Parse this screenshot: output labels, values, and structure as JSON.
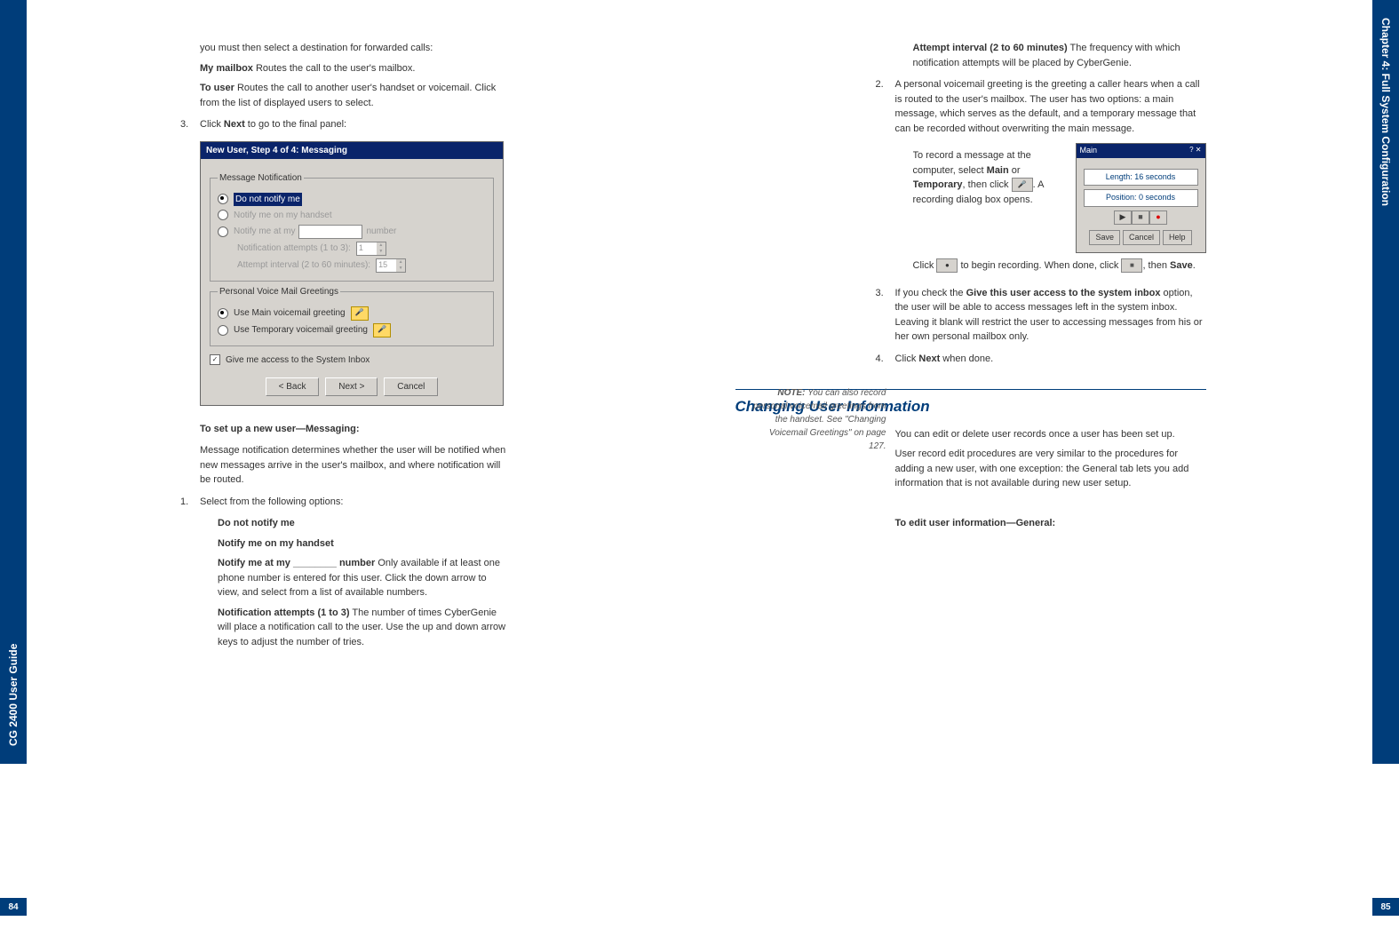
{
  "leftTab": "CG 2400 User Guide",
  "rightTab": "Chapter 4: Full System Configuration",
  "pageNumLeft": "84",
  "pageNumRight": "85",
  "left": {
    "intro": "you must then select a destination for forwarded calls:",
    "myMailbox": "My mailbox",
    "myMailboxDesc": "  Routes the call to the user's mailbox.",
    "toUser": "To user",
    "toUserDesc": "  Routes the call to another user's handset or voicemail. Click from the list of displayed users to select.",
    "step3num": "3.",
    "step3a": "Click ",
    "step3b": "Next",
    "step3c": " to go to the final panel:",
    "dlg": {
      "title": "New User, Step 4 of 4: Messaging",
      "grpNotif": "Message Notification",
      "optDont": "Do not notify me",
      "optHandset": "Notify me on my handset",
      "optNumber": "Notify me at my",
      "optNumberTrail": "number",
      "subAttempts": "Notification attempts (1 to 3):",
      "subAttemptsVal": "1",
      "subInterval": "Attempt interval (2 to 60 minutes):",
      "subIntervalVal": "15",
      "grpGreet": "Personal Voice Mail Greetings",
      "optMain": "Use Main voicemail greeting",
      "optTemp": "Use Temporary voicemail greeting",
      "chkAccess": "Give me access to the System Inbox",
      "btnBack": "< Back",
      "btnNext": "Next >",
      "btnCancel": "Cancel"
    },
    "h1": "To set up a new user—Messaging:",
    "p1": "Message notification determines whether the user will be notified when new messages arrive in the user's mailbox, and where notification will be routed.",
    "s1num": "1.",
    "s1": "Select from the following options:",
    "opt1": "Do not notify me",
    "opt2": "Notify me on my handset",
    "opt3a": "Notify me at my ________ number",
    "opt3b": "  Only available if at least one phone number is entered for this user. Click the down arrow to view, and select from a list of available numbers.",
    "opt4a": "Notification attempts (1 to 3)",
    "opt4b": "  The number of times CyberGenie will place a notification call to the user. Use the up and down arrow keys to adjust the number of tries."
  },
  "right": {
    "opt5a": "Attempt interval (2 to 60 minutes)",
    "opt5b": "  The frequency with which notification attempts will be placed by CyberGenie.",
    "s2num": "2.",
    "s2": "A personal voicemail greeting is the greeting a caller hears when a call is routed to the user's mailbox. The user has two options: a main message, which serves as the default, and a temporary message that can be recorded without overwriting the main message.",
    "rec": {
      "title": "Main",
      "length": "Length: 16 seconds",
      "position": "Position: 0 seconds",
      "btnSave": "Save",
      "btnCancel": "Cancel",
      "btnHelp": "Help"
    },
    "recP1a": "To record a message at the computer, select ",
    "recP1b": "Main",
    "recP1c": " or ",
    "recP1d": "Temporary",
    "recP1e": ", then click ",
    "recP1f": ". A recording dialog box opens.",
    "recP2a": "Click ",
    "recP2b": " to begin recording. When done, click ",
    "recP2c": ", then ",
    "recP2d": "Save",
    "recP2e": ".",
    "note": "NOTE:",
    "noteBody": " You can also record personal voicemail greetings from the handset. See \"Changing Voicemail Greetings\" on page 127.",
    "s3num": "3.",
    "s3a": "If you check the ",
    "s3b": "Give this user access to the system inbox",
    "s3c": " option, the user will be able to access messages left in the system inbox. Leaving it blank will restrict the user to accessing messages from his or her own personal mailbox only.",
    "s4num": "4.",
    "s4a": "Click ",
    "s4b": "Next",
    "s4c": " when done.",
    "sectionTitle": "Changing User Information",
    "sp1": "You can edit or delete user records once a user has been set up.",
    "sp2": "User record edit procedures are very similar to the procedures for adding a new user, with one exception: the General tab lets you add information that is not available during new user setup.",
    "h2": "To edit user information—General:"
  }
}
